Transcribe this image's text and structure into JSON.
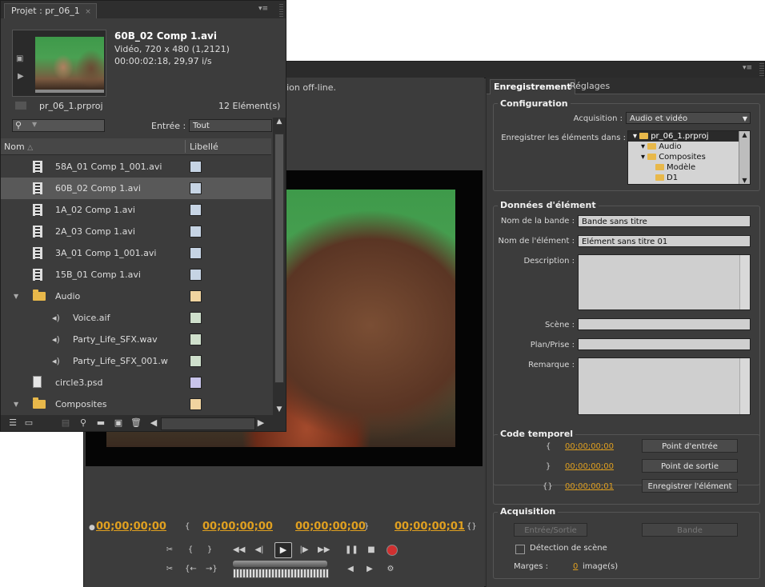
{
  "capture": {
    "offline_message": "sition off-line.",
    "timecodes": {
      "current": "00;00;00;00",
      "in": "00;00;00;00",
      "out": "00;00;00;00",
      "duration": "00;00;00;01"
    },
    "tabs": [
      "Enregistrement",
      "Réglages"
    ],
    "configuration": {
      "title": "Configuration",
      "capture_label": "Acquisition :",
      "capture_value": "Audio et vidéo",
      "save_label": "Enregistrer les éléments dans :",
      "tree": [
        {
          "label": "pr_06_1.prproj",
          "level": 0,
          "selected": true
        },
        {
          "label": "Audio",
          "level": 1
        },
        {
          "label": "Composites",
          "level": 1
        },
        {
          "label": "Modèle",
          "level": 2
        },
        {
          "label": "D1",
          "level": 2
        }
      ]
    },
    "clip_data": {
      "title": "Données d'élément",
      "tape_label": "Nom de la bande :",
      "tape_value": "Bande sans titre",
      "clip_label": "Nom de l'élément :",
      "clip_value": "Elément sans titre 01",
      "description_label": "Description :",
      "scene_label": "Scène :",
      "shot_label": "Plan/Prise :",
      "comment_label": "Remarque :"
    },
    "timecode": {
      "title": "Code temporel",
      "in_value": "00;00;00;00",
      "out_value": "00;00;00;00",
      "dur_value": "00;00;00;01",
      "in_button": "Point d'entrée",
      "out_button": "Point de sortie",
      "log_button": "Enregistrer l'élément"
    },
    "acquisition": {
      "title": "Acquisition",
      "inout_button": "Entrée/Sortie",
      "tape_button": "Bande",
      "scene_detect": "Détection de scène",
      "handles_label": "Marges :",
      "handles_value": "0",
      "handles_unit": "image(s)"
    }
  },
  "project": {
    "tab": "Projet : pr_06_1",
    "clip_name": "60B_02 Comp 1.avi",
    "clip_info1": "Vidéo, 720 x 480 (1,2121)",
    "clip_info2": "00:00:02:18, 29,97 i/s",
    "file_name": "pr_06_1.prproj",
    "item_count": "12 Elément(s)",
    "entry_label": "Entrée :",
    "entry_value": "Tout",
    "col_name": "Nom",
    "col_label": "Libellé",
    "items": [
      {
        "name": "58A_01 Comp 1_001.avi",
        "type": "video",
        "color": "#c6d4e4"
      },
      {
        "name": "60B_02 Comp 1.avi",
        "type": "video",
        "color": "#c6d4e4",
        "selected": true
      },
      {
        "name": "1A_02 Comp 1.avi",
        "type": "video",
        "color": "#c6d4e4"
      },
      {
        "name": "2A_03 Comp 1.avi",
        "type": "video",
        "color": "#c6d4e4"
      },
      {
        "name": "3A_01 Comp 1_001.avi",
        "type": "video",
        "color": "#c6d4e4"
      },
      {
        "name": "15B_01 Comp 1.avi",
        "type": "video",
        "color": "#c6d4e4"
      },
      {
        "name": "Audio",
        "type": "folder",
        "color": "#f0d4a0"
      },
      {
        "name": "Voice.aif",
        "type": "audio",
        "color": "#cfe0cc"
      },
      {
        "name": "Party_Life_SFX.wav",
        "type": "audio",
        "color": "#cfe0cc"
      },
      {
        "name": "Party_Life_SFX_001.w",
        "type": "audio",
        "color": "#cfe0cc"
      },
      {
        "name": "circle3.psd",
        "type": "image",
        "color": "#c8c4ea"
      },
      {
        "name": "Composites",
        "type": "folder",
        "color": "#f0d4a0"
      }
    ]
  }
}
